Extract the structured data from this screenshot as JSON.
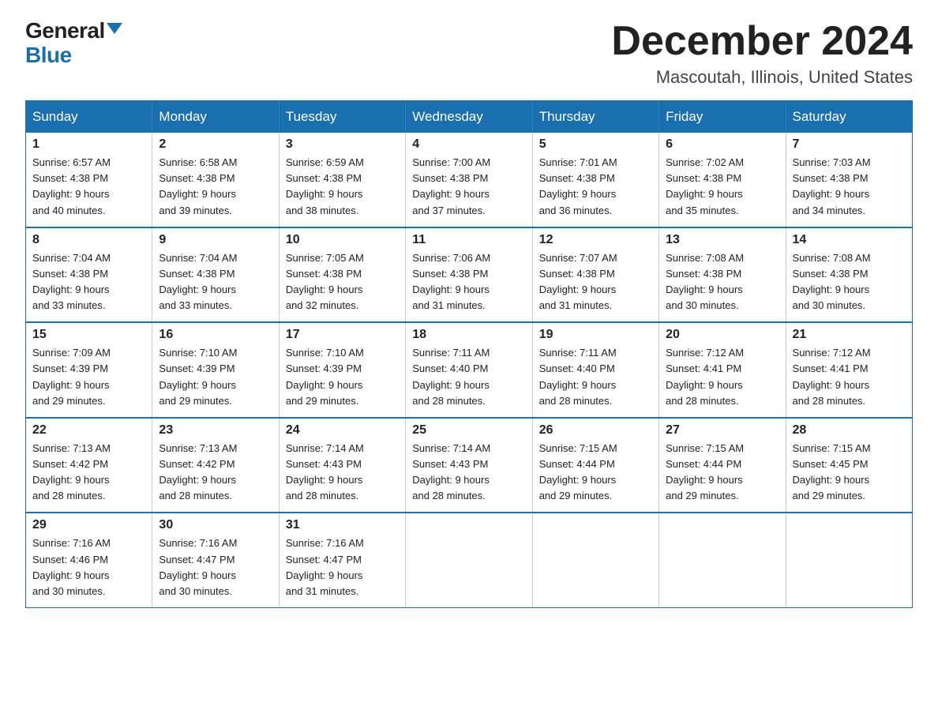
{
  "logo": {
    "general": "General",
    "blue": "Blue"
  },
  "title": {
    "month": "December 2024",
    "location": "Mascoutah, Illinois, United States"
  },
  "weekdays": [
    "Sunday",
    "Monday",
    "Tuesday",
    "Wednesday",
    "Thursday",
    "Friday",
    "Saturday"
  ],
  "weeks": [
    [
      {
        "day": "1",
        "sunrise": "6:57 AM",
        "sunset": "4:38 PM",
        "daylight": "9 hours and 40 minutes."
      },
      {
        "day": "2",
        "sunrise": "6:58 AM",
        "sunset": "4:38 PM",
        "daylight": "9 hours and 39 minutes."
      },
      {
        "day": "3",
        "sunrise": "6:59 AM",
        "sunset": "4:38 PM",
        "daylight": "9 hours and 38 minutes."
      },
      {
        "day": "4",
        "sunrise": "7:00 AM",
        "sunset": "4:38 PM",
        "daylight": "9 hours and 37 minutes."
      },
      {
        "day": "5",
        "sunrise": "7:01 AM",
        "sunset": "4:38 PM",
        "daylight": "9 hours and 36 minutes."
      },
      {
        "day": "6",
        "sunrise": "7:02 AM",
        "sunset": "4:38 PM",
        "daylight": "9 hours and 35 minutes."
      },
      {
        "day": "7",
        "sunrise": "7:03 AM",
        "sunset": "4:38 PM",
        "daylight": "9 hours and 34 minutes."
      }
    ],
    [
      {
        "day": "8",
        "sunrise": "7:04 AM",
        "sunset": "4:38 PM",
        "daylight": "9 hours and 33 minutes."
      },
      {
        "day": "9",
        "sunrise": "7:04 AM",
        "sunset": "4:38 PM",
        "daylight": "9 hours and 33 minutes."
      },
      {
        "day": "10",
        "sunrise": "7:05 AM",
        "sunset": "4:38 PM",
        "daylight": "9 hours and 32 minutes."
      },
      {
        "day": "11",
        "sunrise": "7:06 AM",
        "sunset": "4:38 PM",
        "daylight": "9 hours and 31 minutes."
      },
      {
        "day": "12",
        "sunrise": "7:07 AM",
        "sunset": "4:38 PM",
        "daylight": "9 hours and 31 minutes."
      },
      {
        "day": "13",
        "sunrise": "7:08 AM",
        "sunset": "4:38 PM",
        "daylight": "9 hours and 30 minutes."
      },
      {
        "day": "14",
        "sunrise": "7:08 AM",
        "sunset": "4:38 PM",
        "daylight": "9 hours and 30 minutes."
      }
    ],
    [
      {
        "day": "15",
        "sunrise": "7:09 AM",
        "sunset": "4:39 PM",
        "daylight": "9 hours and 29 minutes."
      },
      {
        "day": "16",
        "sunrise": "7:10 AM",
        "sunset": "4:39 PM",
        "daylight": "9 hours and 29 minutes."
      },
      {
        "day": "17",
        "sunrise": "7:10 AM",
        "sunset": "4:39 PM",
        "daylight": "9 hours and 29 minutes."
      },
      {
        "day": "18",
        "sunrise": "7:11 AM",
        "sunset": "4:40 PM",
        "daylight": "9 hours and 28 minutes."
      },
      {
        "day": "19",
        "sunrise": "7:11 AM",
        "sunset": "4:40 PM",
        "daylight": "9 hours and 28 minutes."
      },
      {
        "day": "20",
        "sunrise": "7:12 AM",
        "sunset": "4:41 PM",
        "daylight": "9 hours and 28 minutes."
      },
      {
        "day": "21",
        "sunrise": "7:12 AM",
        "sunset": "4:41 PM",
        "daylight": "9 hours and 28 minutes."
      }
    ],
    [
      {
        "day": "22",
        "sunrise": "7:13 AM",
        "sunset": "4:42 PM",
        "daylight": "9 hours and 28 minutes."
      },
      {
        "day": "23",
        "sunrise": "7:13 AM",
        "sunset": "4:42 PM",
        "daylight": "9 hours and 28 minutes."
      },
      {
        "day": "24",
        "sunrise": "7:14 AM",
        "sunset": "4:43 PM",
        "daylight": "9 hours and 28 minutes."
      },
      {
        "day": "25",
        "sunrise": "7:14 AM",
        "sunset": "4:43 PM",
        "daylight": "9 hours and 28 minutes."
      },
      {
        "day": "26",
        "sunrise": "7:15 AM",
        "sunset": "4:44 PM",
        "daylight": "9 hours and 29 minutes."
      },
      {
        "day": "27",
        "sunrise": "7:15 AM",
        "sunset": "4:44 PM",
        "daylight": "9 hours and 29 minutes."
      },
      {
        "day": "28",
        "sunrise": "7:15 AM",
        "sunset": "4:45 PM",
        "daylight": "9 hours and 29 minutes."
      }
    ],
    [
      {
        "day": "29",
        "sunrise": "7:16 AM",
        "sunset": "4:46 PM",
        "daylight": "9 hours and 30 minutes."
      },
      {
        "day": "30",
        "sunrise": "7:16 AM",
        "sunset": "4:47 PM",
        "daylight": "9 hours and 30 minutes."
      },
      {
        "day": "31",
        "sunrise": "7:16 AM",
        "sunset": "4:47 PM",
        "daylight": "9 hours and 31 minutes."
      },
      null,
      null,
      null,
      null
    ]
  ],
  "labels": {
    "sunrise": "Sunrise:",
    "sunset": "Sunset:",
    "daylight": "Daylight:"
  }
}
